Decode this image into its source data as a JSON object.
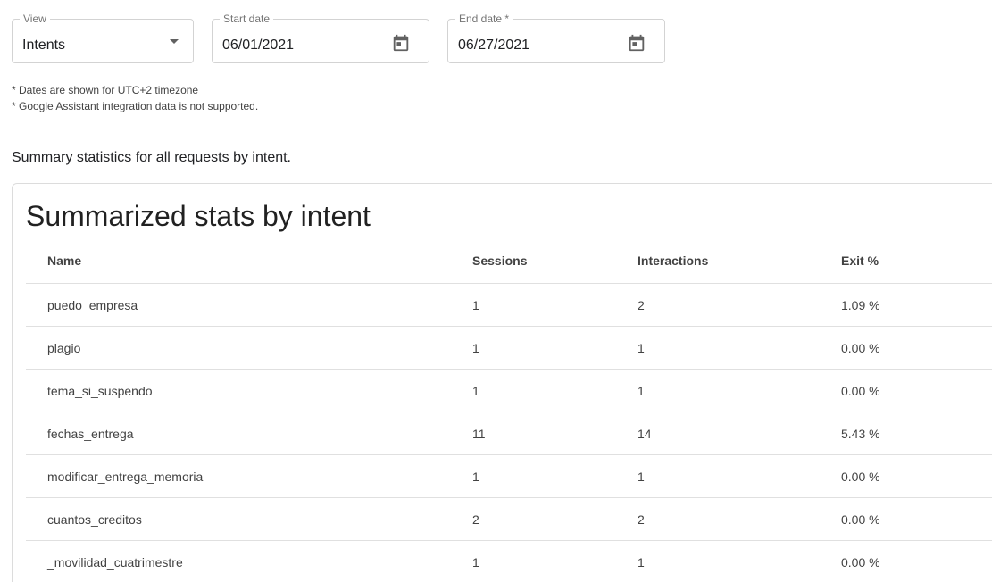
{
  "filters": {
    "view": {
      "label": "View",
      "value": "Intents",
      "icon": "chevron-down-icon"
    },
    "start_date": {
      "label": "Start date",
      "value": "06/01/2021",
      "icon": "calendar-icon"
    },
    "end_date": {
      "label": "End date *",
      "value": "06/27/2021",
      "icon": "calendar-icon"
    }
  },
  "notes": [
    "* Dates are shown for UTC+2 timezone",
    "* Google Assistant integration data is not supported."
  ],
  "summary_text": "Summary statistics for all requests by intent.",
  "card": {
    "title": "Summarized stats by intent",
    "columns": [
      "Name",
      "Sessions",
      "Interactions",
      "Exit %"
    ],
    "rows": [
      [
        "puedo_empresa",
        "1",
        "2",
        "1.09 %"
      ],
      [
        "plagio",
        "1",
        "1",
        "0.00 %"
      ],
      [
        "tema_si_suspendo",
        "1",
        "1",
        "0.00 %"
      ],
      [
        "fechas_entrega",
        "11",
        "14",
        "5.43 %"
      ],
      [
        "modificar_entrega_memoria",
        "1",
        "1",
        "0.00 %"
      ],
      [
        "cuantos_creditos",
        "2",
        "2",
        "0.00 %"
      ],
      [
        "_movilidad_cuatrimestre",
        "1",
        "1",
        "0.00 %"
      ]
    ]
  },
  "colors": {
    "border": "#d3d3d3",
    "text": "#202124",
    "muted": "#757575",
    "row_divider": "#e0e0e0"
  }
}
